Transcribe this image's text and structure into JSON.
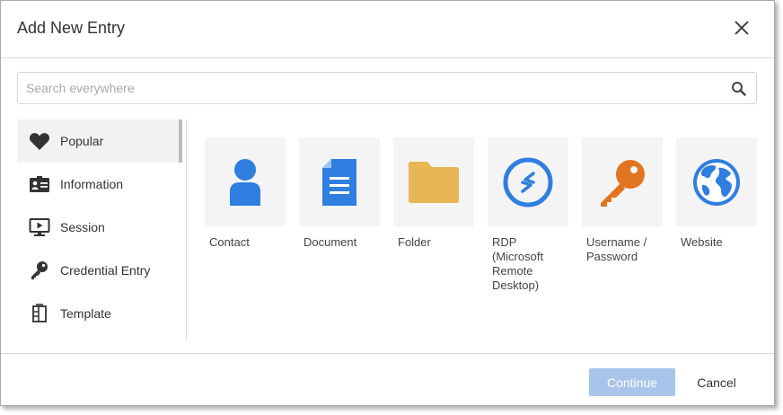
{
  "dialog": {
    "title": "Add New Entry"
  },
  "search": {
    "placeholder": "Search everywhere"
  },
  "sidebar": {
    "items": [
      {
        "label": "Popular",
        "icon": "heart-icon",
        "active": true
      },
      {
        "label": "Information",
        "icon": "id-card-icon",
        "active": false
      },
      {
        "label": "Session",
        "icon": "monitor-play-icon",
        "active": false
      },
      {
        "label": "Credential Entry",
        "icon": "key-icon",
        "active": false
      },
      {
        "label": "Template",
        "icon": "template-icon",
        "active": false
      }
    ]
  },
  "tiles": [
    {
      "label": "Contact",
      "icon": "person-icon"
    },
    {
      "label": "Document",
      "icon": "document-icon"
    },
    {
      "label": "Folder",
      "icon": "folder-icon"
    },
    {
      "label": "RDP (Microsoft Remote Desktop)",
      "icon": "rdp-icon"
    },
    {
      "label": "Username / Password",
      "icon": "key-icon"
    },
    {
      "label": "Website",
      "icon": "globe-icon"
    }
  ],
  "footer": {
    "continue_label": "Continue",
    "cancel_label": "Cancel"
  },
  "colors": {
    "accent_blue": "#2f7ee0",
    "folder_yellow": "#e8b655",
    "key_orange": "#e0741f",
    "continue_disabled": "#a9c4ea"
  }
}
